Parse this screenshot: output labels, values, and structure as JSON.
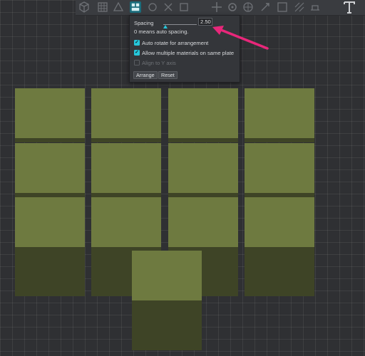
{
  "toolbar": {
    "icons": [
      "cube-icon",
      "grid-icon",
      "shapes-icon",
      "arrange-icon",
      "move-icon",
      "rotate-icon",
      "scale-icon",
      "paint-icon",
      "cut-icon",
      "text-icon"
    ],
    "active_icon": "arrange-icon",
    "accent_color": "#1b6d7c"
  },
  "arrange_panel": {
    "spacing_label": "Spacing",
    "spacing_value": "2.50",
    "slider_level": 0,
    "hint": "0 means auto spacing.",
    "options": [
      {
        "label": "Auto rotate for arrangement",
        "checked": true,
        "enabled": true
      },
      {
        "label": "Allow multiple materials on same plate",
        "checked": true,
        "enabled": true
      },
      {
        "label": "Align to Y axis",
        "checked": false,
        "enabled": false
      }
    ],
    "arrange_label": "Arrange",
    "reset_label": "Reset",
    "accent_color": "#26c6da"
  },
  "annotation": {
    "arrow_color": "#e8277a"
  },
  "scene": {
    "part_top_color": "#6e7a40",
    "part_side_color": "#3e4426",
    "part_count": 13
  }
}
